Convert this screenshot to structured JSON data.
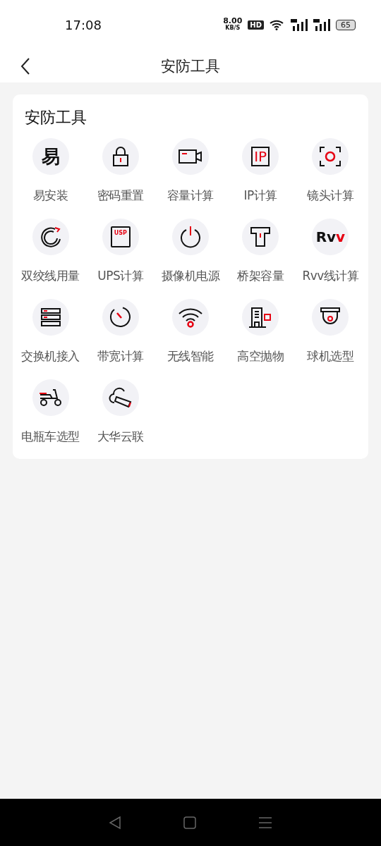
{
  "status_bar": {
    "time": "17:08",
    "speed": "8.00",
    "speed_unit": "KB/S",
    "hd": "HD",
    "battery": "65"
  },
  "header": {
    "title": "安防工具"
  },
  "card": {
    "title": "安防工具",
    "tools": [
      {
        "label": "易安装",
        "kind": "glyph",
        "glyph": "易"
      },
      {
        "label": "密码重置",
        "kind": "lock"
      },
      {
        "label": "容量计算",
        "kind": "camera"
      },
      {
        "label": "IP计算",
        "kind": "framed",
        "glyph": "IP"
      },
      {
        "label": "镜头计算",
        "kind": "lens"
      },
      {
        "label": "双绞线用量",
        "kind": "cable"
      },
      {
        "label": "UPS计算",
        "kind": "drive",
        "glyph": "USP"
      },
      {
        "label": "摄像机电源",
        "kind": "power"
      },
      {
        "label": "桥架容量",
        "kind": "tray"
      },
      {
        "label": "Rvv线计算",
        "kind": "twotone",
        "glyph": "Rv",
        "accent": "v"
      },
      {
        "label": "交换机接入",
        "kind": "switch"
      },
      {
        "label": "带宽计算",
        "kind": "timer"
      },
      {
        "label": "无线智能",
        "kind": "wifi"
      },
      {
        "label": "高空抛物",
        "kind": "building"
      },
      {
        "label": "球机选型",
        "kind": "dome"
      },
      {
        "label": "电瓶车选型",
        "kind": "scooter"
      },
      {
        "label": "大华云联",
        "kind": "cloud"
      }
    ]
  }
}
